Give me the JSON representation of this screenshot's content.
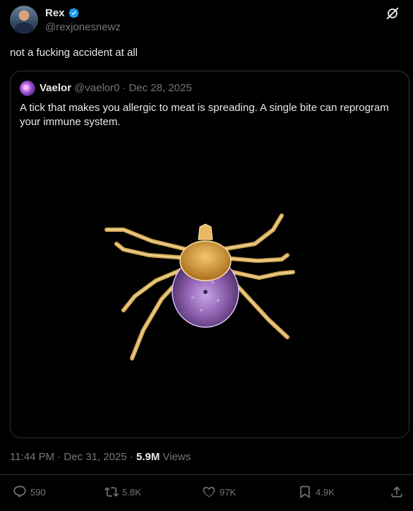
{
  "author": {
    "display_name": "Rex",
    "handle": "@rexjonesnewz",
    "verified": true
  },
  "tweet": {
    "text": "not a fucking accident at all"
  },
  "quoted": {
    "display_name": "Vaelor",
    "handle": "@vaelor0",
    "separator": "·",
    "date": "Dec 28, 2025",
    "text": "A tick that makes you allergic to meat is spreading. A single bite can reprogram your immune system."
  },
  "meta": {
    "time": "11:44 PM · Dec 31, 2025 · ",
    "views_count": "5.9M",
    "views_label": " Views"
  },
  "actions": {
    "replies": "590",
    "reposts": "5.8K",
    "likes": "97K",
    "bookmarks": "4.9K"
  },
  "colors": {
    "background": "#000000",
    "text": "#e7e9ea",
    "muted": "#71767b",
    "border": "#2f3336",
    "verified_blue": "#1d9bf0"
  },
  "icons": [
    "verified-badge-icon",
    "grok-icon",
    "reply-icon",
    "repost-icon",
    "like-icon",
    "bookmark-icon",
    "share-icon"
  ]
}
